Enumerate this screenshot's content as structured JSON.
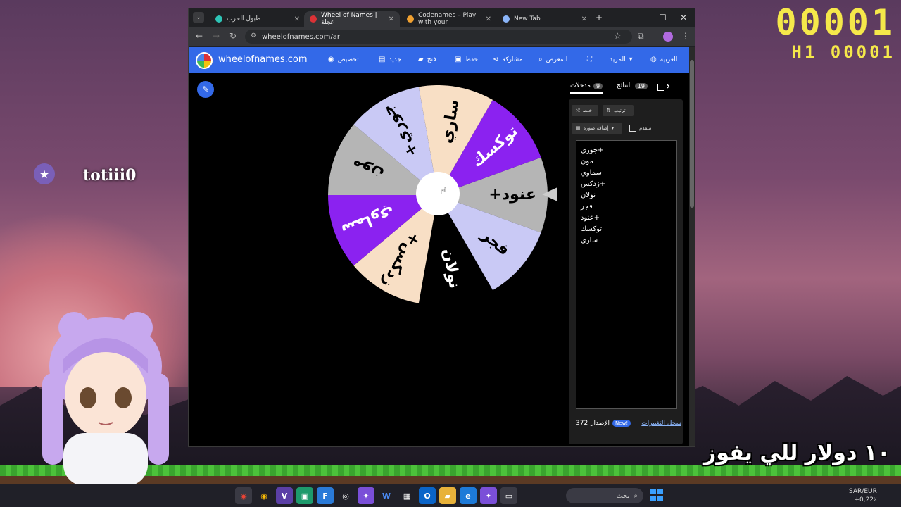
{
  "overlay": {
    "timer_main": "00001",
    "timer_sub": "H1 00001",
    "streamer_name": "totiii0",
    "prize_text": "١٠ دولار للي يفوز"
  },
  "browser": {
    "tabs": [
      {
        "label": "طبول الحرب",
        "active": false,
        "favicon_color": "#2ec4b6"
      },
      {
        "label": "Wheel of Names | عجلة",
        "active": true,
        "favicon_color": "#db3236"
      },
      {
        "label": "Codenames – Play with your",
        "active": false,
        "favicon_color": "#f0a030"
      },
      {
        "label": "New Tab",
        "active": false,
        "favicon_color": "#8ab4f8"
      }
    ],
    "url": "wheelofnames.com/ar"
  },
  "site": {
    "title": "wheelofnames.com",
    "menu": [
      {
        "label": "تخصيص",
        "icon": "palette-icon"
      },
      {
        "label": "جديد",
        "icon": "file-icon"
      },
      {
        "label": "فتح",
        "icon": "folder-icon"
      },
      {
        "label": "حفظ",
        "icon": "save-icon"
      },
      {
        "label": "مشاركة",
        "icon": "share-icon"
      },
      {
        "label": "المعرض",
        "icon": "search-icon"
      },
      {
        "label": "",
        "icon": "fullscreen-icon"
      },
      {
        "label": "المزيد",
        "icon": "chevron-down-icon"
      },
      {
        "label": "العربية",
        "icon": "globe-icon"
      }
    ]
  },
  "wheel": {
    "colors": {
      "lavender": "#c9c9f5",
      "cream": "#f8dfc5",
      "purple": "#8b22f0",
      "gray": "#b5b5b5",
      "black": "#000000"
    },
    "segments": [
      {
        "label": "+عنود",
        "color": "#b5b5b5",
        "text_color": "#000000"
      },
      {
        "label": "فجر",
        "color": "#c9c9f5",
        "text_color": "#000000"
      },
      {
        "label": "نولان",
        "color": "#000000",
        "text_color": "#ffffff"
      },
      {
        "label": "+زدكس",
        "color": "#f8dfc5",
        "text_color": "#000000"
      },
      {
        "label": "سماوي",
        "color": "#8b22f0",
        "text_color": "#ffffff"
      },
      {
        "label": "مون",
        "color": "#b5b5b5",
        "text_color": "#000000"
      },
      {
        "label": "+جوري",
        "color": "#c9c9f5",
        "text_color": "#000000"
      },
      {
        "label": "ساري",
        "color": "#f8dfc5",
        "text_color": "#000000"
      },
      {
        "label": "توكسك",
        "color": "#8b22f0",
        "text_color": "#ffffff"
      }
    ]
  },
  "panel": {
    "tab_entries": "مدخلات",
    "tab_entries_count": "9",
    "tab_results": "النتائج",
    "tab_results_count": "19",
    "tab_hide": "إخفاء",
    "shuffle_label": "خلط",
    "sort_label": "ترتيب",
    "add_image_label": "إضافة صورة",
    "advanced_label": "متقدم",
    "entries": [
      "+جوري",
      "مون",
      "سماوي",
      "+زدكس",
      "نولان",
      "فجر",
      "+عنود",
      "توكسك",
      "ساري"
    ],
    "version_label": "الإصدار",
    "version_number": "372",
    "new_badge": "New!",
    "changelog_label": "سجل التغييرات"
  },
  "taskbar": {
    "search_placeholder": "بحث",
    "currency_pair": "SAR/EUR",
    "currency_change": "+0,22٪"
  }
}
